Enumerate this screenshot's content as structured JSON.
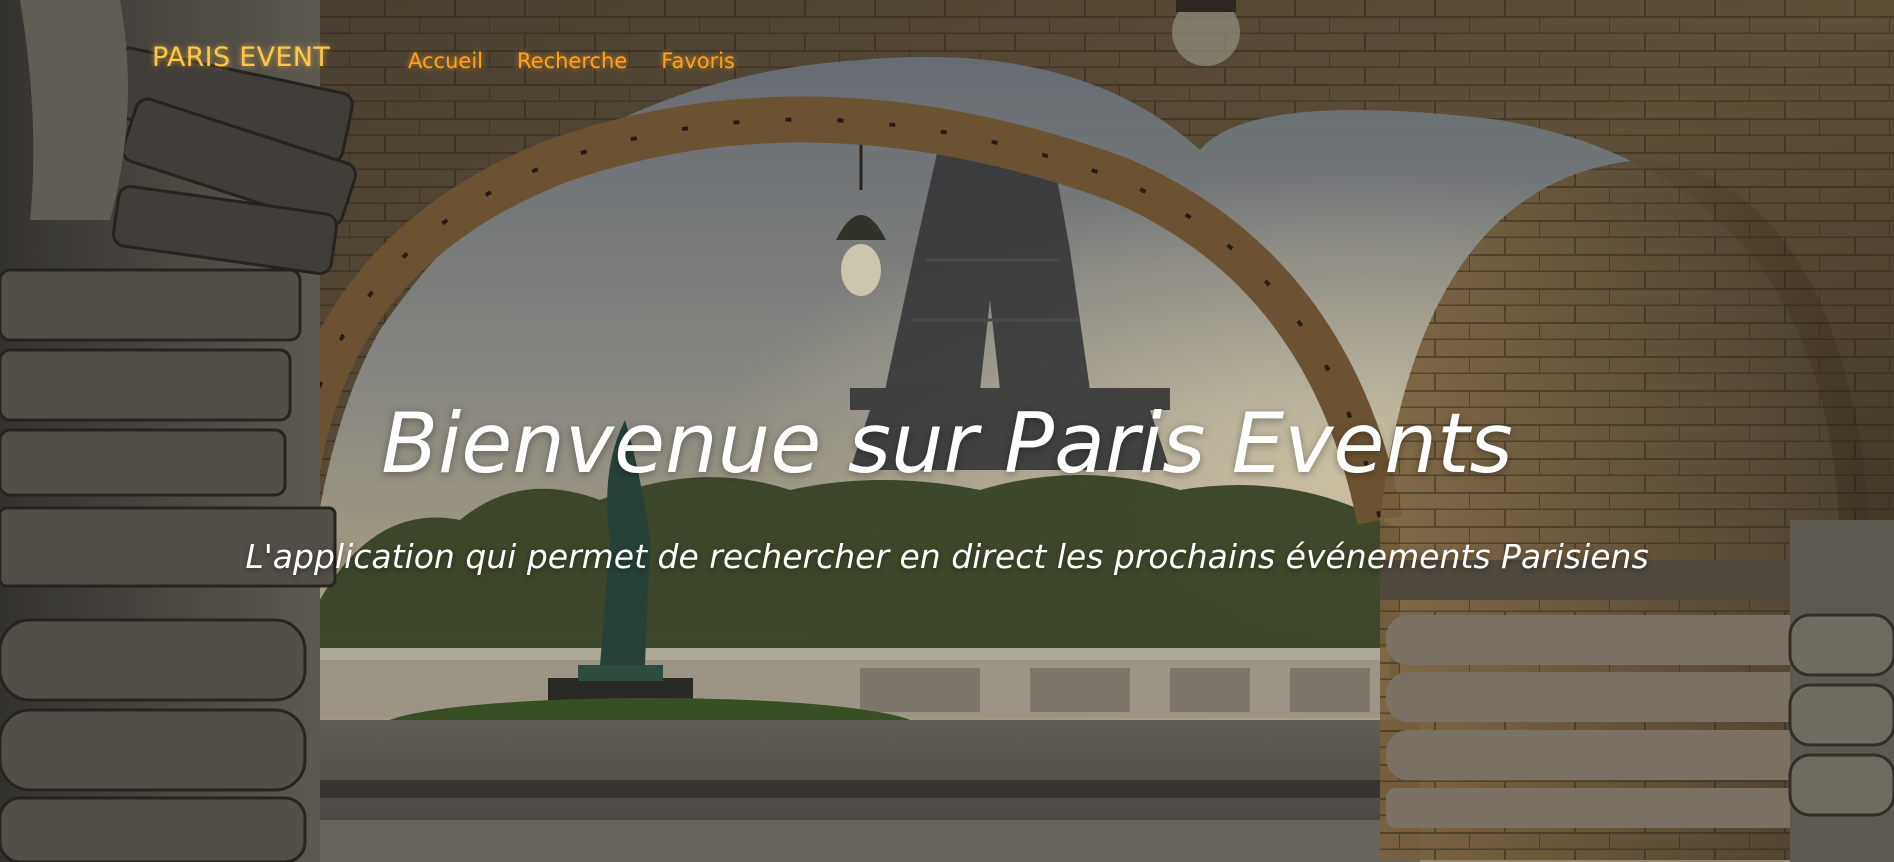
{
  "navbar": {
    "brand": "PARIS EVENT",
    "links": [
      {
        "label": "Accueil"
      },
      {
        "label": "Recherche"
      },
      {
        "label": "Favoris"
      }
    ]
  },
  "hero": {
    "title": "Bienvenue sur Paris Events",
    "subtitle": "L'application qui permet de rechercher en direct les prochains événements Parisiens",
    "background": "photo of the Eiffel Tower seen through a stone bridge arch at sunrise"
  },
  "colors": {
    "brand": "#ffc74a",
    "nav_link": "#ffa31a",
    "hero_text": "#ffffff"
  }
}
